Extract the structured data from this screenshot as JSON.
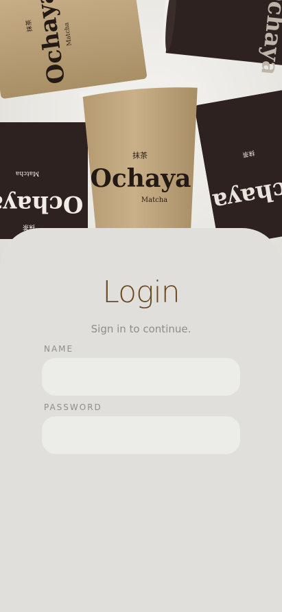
{
  "hero": {
    "brand_name": "Ochaya",
    "brand_kanji": "抹茶",
    "brand_sub": "Matcha",
    "cup_colors": {
      "kraft": "#bfa57c",
      "dark": "#2d2220",
      "rim": "#efefec"
    }
  },
  "login": {
    "title": "Login",
    "subtitle": "Sign in to continue.",
    "name_label": "NAME",
    "name_value": "",
    "password_label": "PASSWORD",
    "password_value": ""
  },
  "colors": {
    "accent": "#6b4a22",
    "background": "#e0dfdb",
    "field": "#ecece8"
  }
}
